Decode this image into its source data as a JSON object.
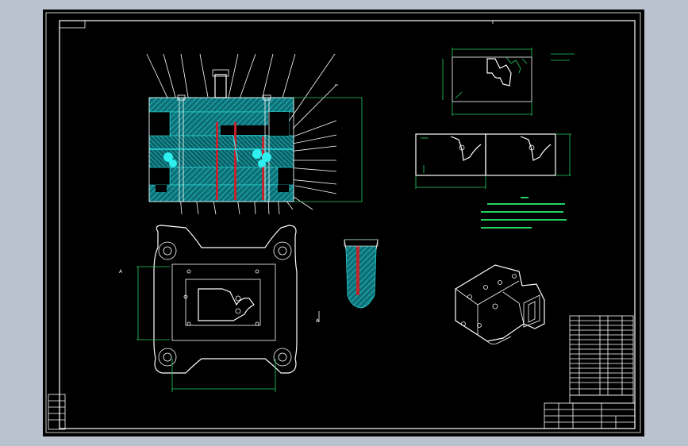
{
  "drawing": {
    "background": "#000000",
    "frame_color": "#ffffff",
    "dimension_color": "#23d160",
    "hatch_color": "#19c8c8",
    "core_color": "#c0252d"
  },
  "views": [
    {
      "name": "assembly-section-view"
    },
    {
      "name": "top-plan-view"
    },
    {
      "name": "core-detail-view"
    },
    {
      "name": "part-detail-view"
    },
    {
      "name": "cavity-layout-view"
    },
    {
      "name": "isometric-view"
    }
  ]
}
